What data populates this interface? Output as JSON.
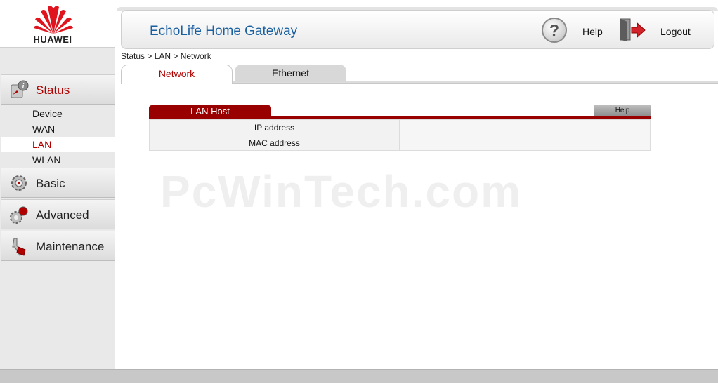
{
  "app": {
    "brand": "HUAWEI",
    "title": "EchoLife Home Gateway",
    "accent_color": "#b00000",
    "title_color": "#1a5fa0"
  },
  "header": {
    "help_label": "Help",
    "logout_label": "Logout",
    "help_icon": "question-icon",
    "logout_icon": "door-exit-icon"
  },
  "sidebar": {
    "sections": [
      {
        "label": "Status",
        "icon": "status-info-icon",
        "active": true
      },
      {
        "label": "Basic",
        "icon": "gear-icon",
        "active": false
      },
      {
        "label": "Advanced",
        "icon": "advanced-tools-icon",
        "active": false
      },
      {
        "label": "Maintenance",
        "icon": "wrench-icon",
        "active": false
      }
    ],
    "status_items": [
      {
        "label": "Device",
        "active": false
      },
      {
        "label": "WAN",
        "active": false
      },
      {
        "label": "LAN",
        "active": true
      },
      {
        "label": "WLAN",
        "active": false
      }
    ]
  },
  "breadcrumb": "Status > LAN > Network",
  "tabs": [
    {
      "label": "Network",
      "active": true
    },
    {
      "label": "Ethernet",
      "active": false
    }
  ],
  "watermark": "PcWinTech.com",
  "panel": {
    "title": "LAN Host",
    "help_label": "Help",
    "rows": [
      {
        "label": "IP address",
        "value": ""
      },
      {
        "label": "MAC address",
        "value": ""
      }
    ]
  }
}
